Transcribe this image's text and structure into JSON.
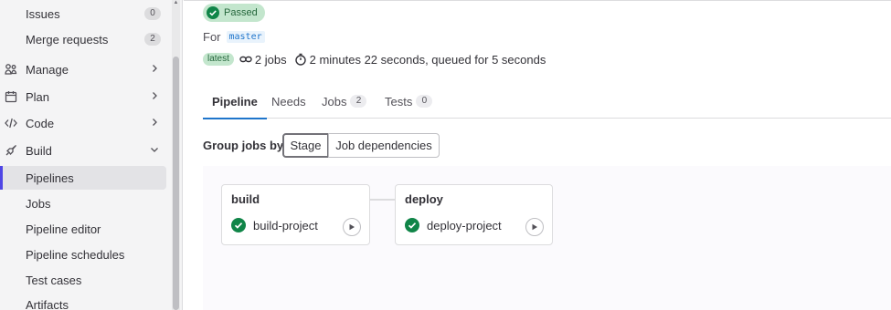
{
  "sidebar": {
    "items": [
      {
        "label": "Issues",
        "count": "0"
      },
      {
        "label": "Merge requests",
        "count": "2"
      },
      {
        "label": "Manage",
        "icon": "manage-icon"
      },
      {
        "label": "Plan",
        "icon": "calendar-icon"
      },
      {
        "label": "Code",
        "icon": "code-icon"
      },
      {
        "label": "Build",
        "icon": "rocket-icon"
      },
      {
        "label": "Pipelines"
      },
      {
        "label": "Jobs"
      },
      {
        "label": "Pipeline editor"
      },
      {
        "label": "Pipeline schedules"
      },
      {
        "label": "Test cases"
      },
      {
        "label": "Artifacts"
      }
    ]
  },
  "pipeline": {
    "status": "Passed",
    "for_label": "For",
    "ref": "master",
    "latest": "latest",
    "jobs_text": "2 jobs",
    "duration_text": "2 minutes 22 seconds, queued for 5 seconds"
  },
  "tabs": [
    {
      "label": "Pipeline"
    },
    {
      "label": "Needs"
    },
    {
      "label": "Jobs",
      "count": "2"
    },
    {
      "label": "Tests",
      "count": "0"
    }
  ],
  "group_by": {
    "label": "Group jobs by",
    "options": [
      "Stage",
      "Job dependencies"
    ],
    "selected": "Stage"
  },
  "stages": [
    {
      "title": "build",
      "job": "build-project",
      "status": "success"
    },
    {
      "title": "deploy",
      "job": "deploy-project",
      "status": "success"
    }
  ],
  "colors": {
    "success": "#108548",
    "accent": "#1f75cb",
    "active_nav": "#4f46e5"
  }
}
